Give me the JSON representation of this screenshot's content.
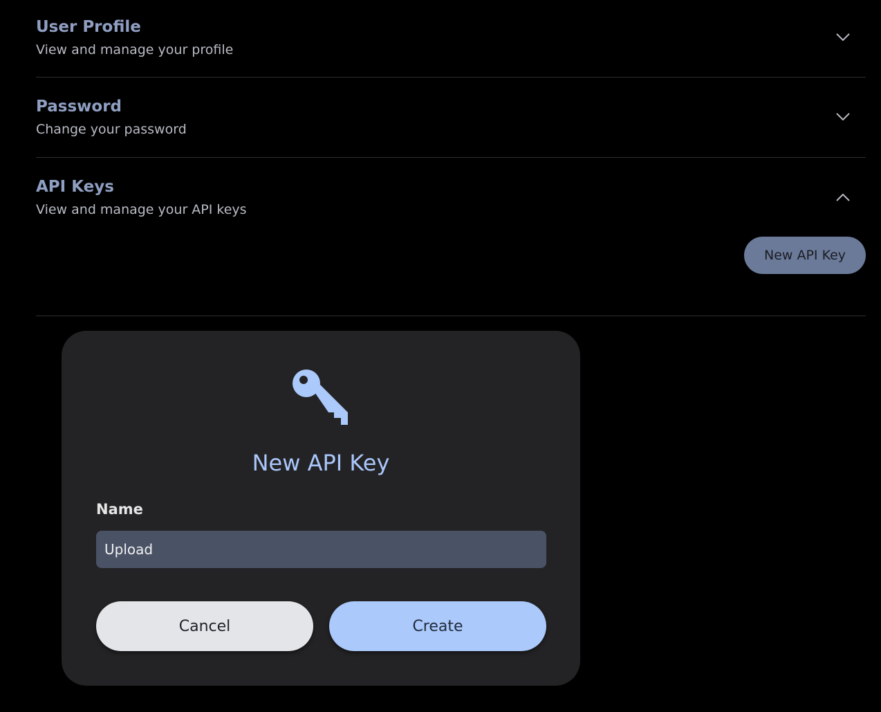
{
  "sections": [
    {
      "title": "User Profile",
      "subtitle": "View and manage your profile",
      "expanded": false
    },
    {
      "title": "Password",
      "subtitle": "Change your password",
      "expanded": false
    },
    {
      "title": "API Keys",
      "subtitle": "View and manage your API keys",
      "expanded": true
    }
  ],
  "api_keys": {
    "new_button_label": "New API Key"
  },
  "modal": {
    "icon": "key-icon",
    "title": "New API Key",
    "name_label": "Name",
    "name_value": "Upload",
    "cancel_label": "Cancel",
    "create_label": "Create"
  },
  "colors": {
    "background": "#000000",
    "section_title": "#8f9fc2",
    "accent": "#abc9fa",
    "modal_bg": "#232325",
    "input_bg": "#4a5366"
  }
}
